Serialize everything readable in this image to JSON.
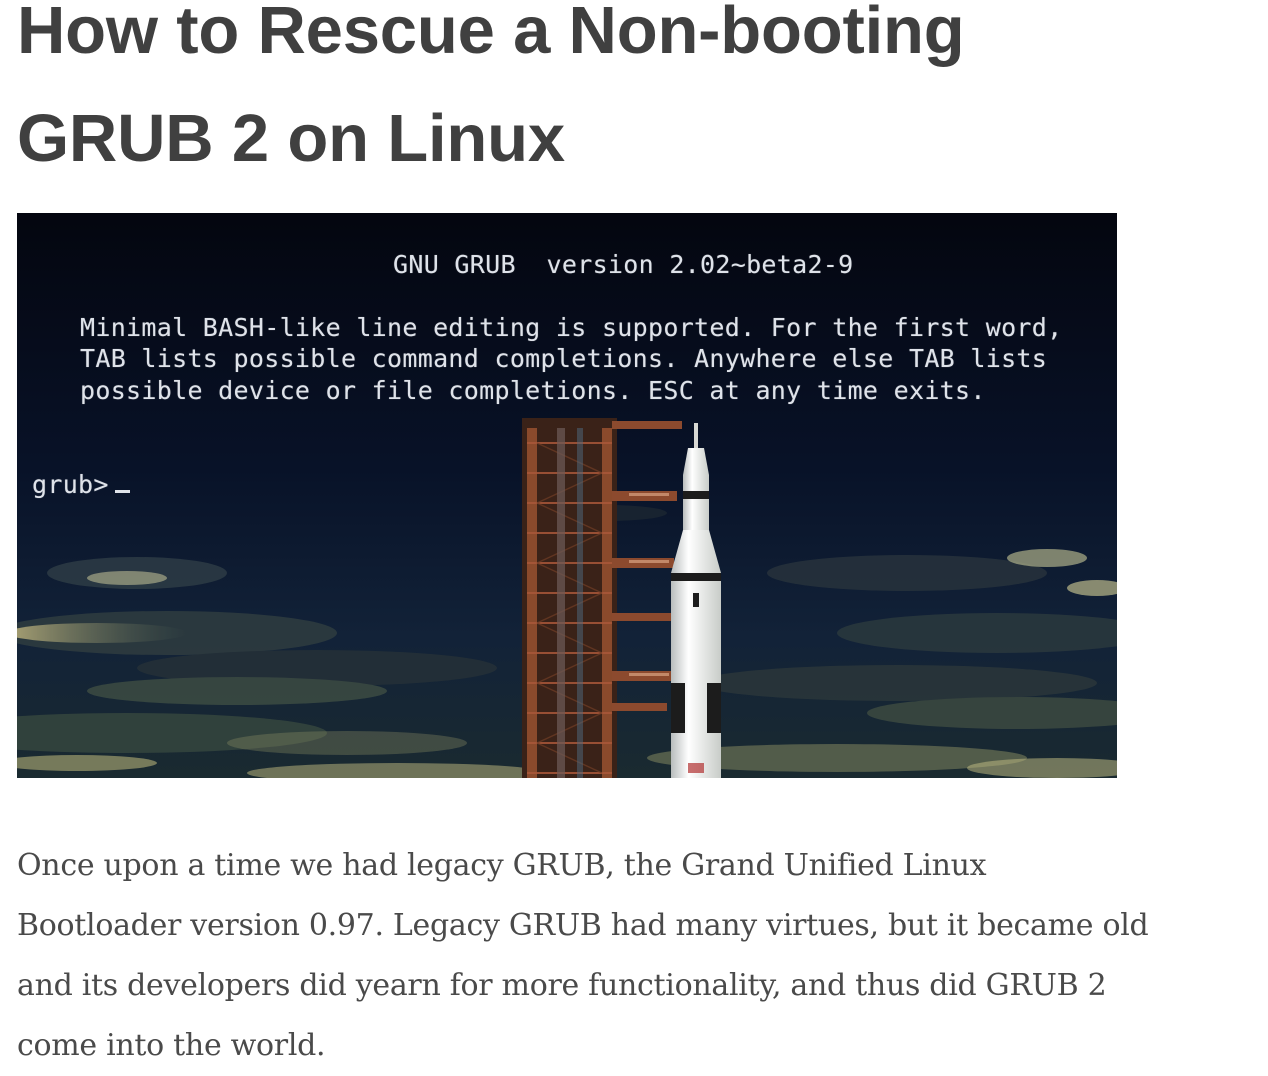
{
  "article": {
    "title": "How to Rescue a Non-booting GRUB 2 on Linux",
    "hero": {
      "console_lines": {
        "header": "GNU GRUB  version 2.02~beta2-9",
        "line1": "Minimal BASH-like line editing is supported. For the first word,",
        "line2": "TAB lists possible command completions. Anywhere else TAB lists",
        "line3": "possible device or file completions. ESC at any time exits.",
        "prompt": "grub>"
      },
      "colors": {
        "sky": "#06091a",
        "console_text": "#dfe3ea",
        "rocket": "#f2f2ee",
        "tower": "#7a3a22"
      }
    },
    "paragraph": "Once upon a time we had legacy GRUB, the Grand Unified Linux Bootloader version 0.97. Legacy GRUB had many virtues, but it became old and its developers did yearn for more functionality, and thus did GRUB 2 come into the world."
  },
  "colors": {
    "title": "#404040",
    "body": "#4a4a4a",
    "background": "#ffffff"
  }
}
